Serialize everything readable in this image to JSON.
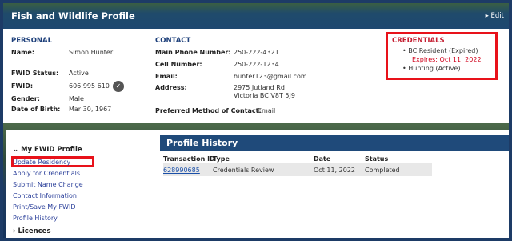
{
  "header": {
    "title": "Fish and Wildlife Profile",
    "edit_label": "▸ Edit"
  },
  "personal": {
    "section_title": "PERSONAL",
    "name_label": "Name:",
    "name_value": "Simon Hunter",
    "status_label": "FWID Status:",
    "status_value": "Active",
    "fwid_label": "FWID:",
    "fwid_value": "606 995 610",
    "gender_label": "Gender:",
    "gender_value": "Male",
    "dob_label": "Date of Birth:",
    "dob_value": "Mar 30, 1967"
  },
  "contact": {
    "section_title": "CONTACT",
    "main_phone_label": "Main Phone Number:",
    "main_phone_value": "250-222-4321",
    "cell_label": "Cell Number:",
    "cell_value": "250-222-1234",
    "email_label": "Email:",
    "email_value": "hunter123@gmail.com",
    "address_label": "Address:",
    "address_line1": "2975 Jutland Rd",
    "address_line2": "Victoria BC V8T 5J9",
    "preferred_label": "Preferred Method of Contact:",
    "preferred_value": "Email"
  },
  "credentials": {
    "section_title": "CREDENTIALS",
    "items": [
      {
        "label": "BC Resident (Expired)",
        "sub": "Expires: Oct 11, 2022"
      },
      {
        "label": "Hunting (Active)"
      }
    ]
  },
  "sidebar": {
    "heading": "⌄  My FWID Profile",
    "items": [
      "Update Residency",
      "Apply for Credentials",
      "Submit Name Change",
      "Contact Information",
      "Print/Save My FWID",
      "Profile History"
    ],
    "heading2": "›  Licences"
  },
  "history": {
    "title": "Profile History",
    "columns": [
      "Transaction ID",
      "Type",
      "Date",
      "Status"
    ],
    "rows": [
      [
        "628990685",
        "Credentials Review",
        "Oct 11, 2022",
        "Completed"
      ]
    ]
  },
  "colors": {
    "header_bg": "#1e4870",
    "link": "#2a3f9a",
    "highlight_border": "#e8121a",
    "section_title": "#1d3f7a"
  }
}
